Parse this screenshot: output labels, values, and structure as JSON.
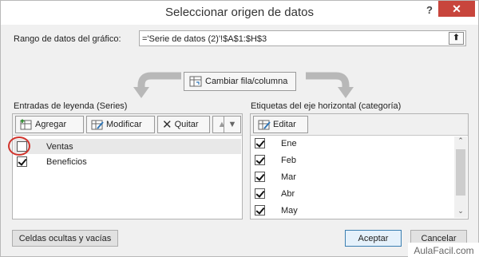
{
  "window": {
    "title": "Seleccionar origen de datos",
    "help_label": "?",
    "close_label": "✕"
  },
  "range": {
    "label": "Rango de datos del gráfico:",
    "value": "='Serie de datos (2)'!$A$1:$H$3"
  },
  "switch_button": {
    "label": "Cambiar fila/columna"
  },
  "legend": {
    "header": "Entradas de leyenda (Series)",
    "add_label": "Agregar",
    "edit_label": "Modificar",
    "remove_label": "Quitar",
    "items": [
      {
        "label": "Ventas",
        "checked": false
      },
      {
        "label": "Beneficios",
        "checked": true
      }
    ]
  },
  "axis": {
    "header": "Etiquetas del eje horizontal (categoría)",
    "edit_label": "Editar",
    "items": [
      {
        "label": "Ene",
        "checked": true
      },
      {
        "label": "Feb",
        "checked": true
      },
      {
        "label": "Mar",
        "checked": true
      },
      {
        "label": "Abr",
        "checked": true
      },
      {
        "label": "May",
        "checked": true
      }
    ]
  },
  "footer": {
    "hidden_cells_label": "Celdas ocultas y vacías",
    "accept_label": "Aceptar",
    "cancel_label": "Cancelar"
  },
  "watermark": "AulaFacil.com",
  "colors": {
    "close": "#c8453c",
    "selected_row": "#e8e8e8",
    "highlight_circle": "#d0342c",
    "primary_border": "#3c7fb1"
  }
}
